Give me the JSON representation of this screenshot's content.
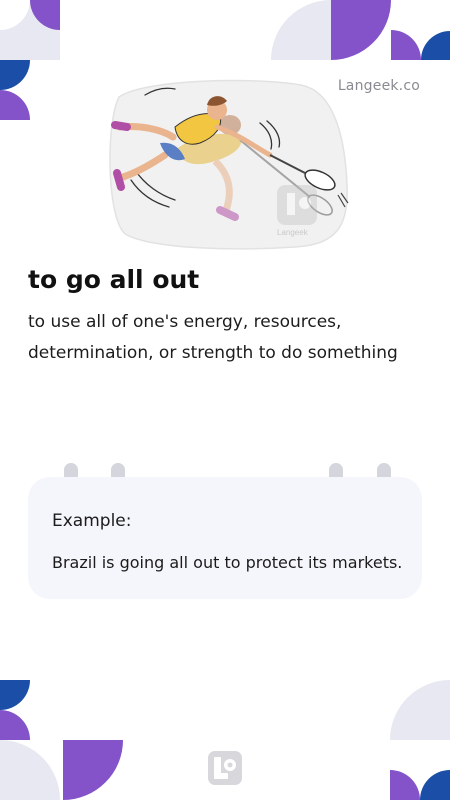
{
  "brand": {
    "name": "Langeek.co",
    "illustration_watermark": "Langeek"
  },
  "entry": {
    "phrase": "to go all out",
    "definition": "to use all of one's energy, resources, determination, or strength to do something"
  },
  "example": {
    "label": "Example:",
    "text": "Brazil is going all out to protect its markets."
  },
  "illustration": {
    "subject": "two badminton players diving to hit a shuttlecock"
  },
  "colors": {
    "purple": "#8452c9",
    "blue": "#1b4fa7",
    "light_gray": "#e7e8f1",
    "card_background": "#f5f6fb"
  }
}
